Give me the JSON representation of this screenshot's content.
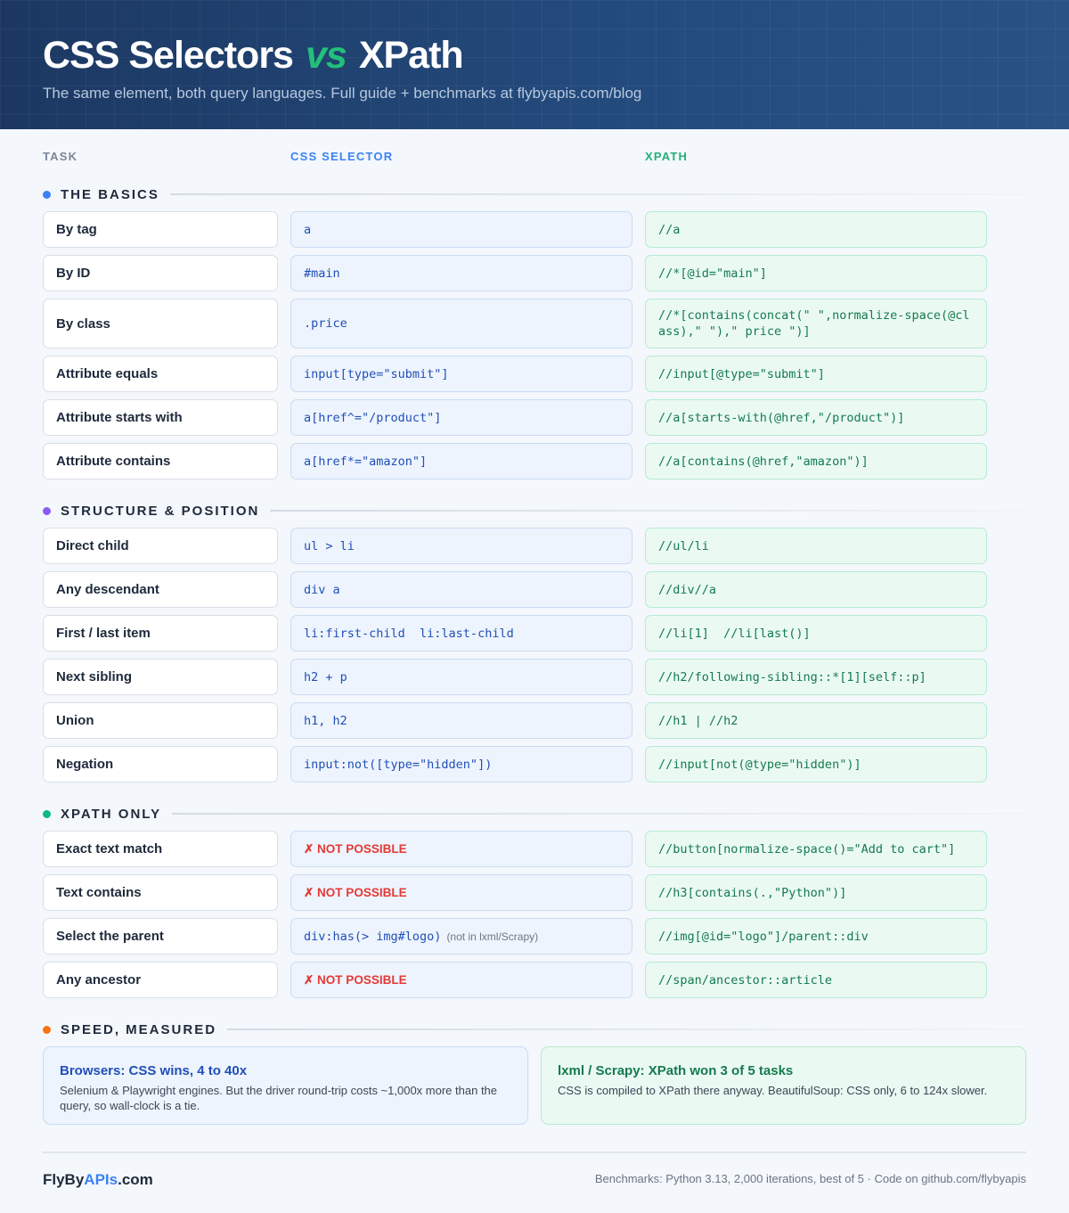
{
  "header": {
    "title_left": "CSS Selectors",
    "title_vs": "vs",
    "title_right": "XPath",
    "subtitle": "The same element, both query languages. Full guide + benchmarks at flybyapis.com/blog"
  },
  "columns": {
    "task": "TASK",
    "css": "CSS SELECTOR",
    "xpath": "XPATH"
  },
  "colors": {
    "css_accent": "#3b82f6",
    "xpath_accent": "#22b07a",
    "not_possible": "#e53935",
    "header_bg": "#22456f"
  },
  "sections": [
    {
      "label": "THE BASICS",
      "dot_color": "#3b82f6",
      "rows": [
        {
          "task": "By tag",
          "css": "a",
          "xpath": "//a"
        },
        {
          "task": "By ID",
          "css": "#main",
          "xpath": "//*[@id=\"main\"]"
        },
        {
          "task": "By class",
          "css": ".price",
          "xpath": "//*[contains(concat(\" \",normalize-space(@class),\" \"),\" price \")]"
        },
        {
          "task": "Attribute equals",
          "css": "input[type=\"submit\"]",
          "xpath": "//input[@type=\"submit\"]"
        },
        {
          "task": "Attribute starts with",
          "css": "a[href^=\"/product\"]",
          "xpath": "//a[starts-with(@href,\"/product\")]"
        },
        {
          "task": "Attribute contains",
          "css": "a[href*=\"amazon\"]",
          "xpath": "//a[contains(@href,\"amazon\")]"
        }
      ]
    },
    {
      "label": "STRUCTURE & POSITION",
      "dot_color": "#8b5cf6",
      "rows": [
        {
          "task": "Direct child",
          "css": "ul > li",
          "xpath": "//ul/li"
        },
        {
          "task": "Any descendant",
          "css": "div a",
          "xpath": "//div//a"
        },
        {
          "task": "First / last item",
          "css": "li:first-child  li:last-child",
          "xpath": "//li[1]  //li[last()]"
        },
        {
          "task": "Next sibling",
          "css": "h2 + p",
          "xpath": "//h2/following-sibling::*[1][self::p]"
        },
        {
          "task": "Union",
          "css": "h1, h2",
          "xpath": "//h1 | //h2"
        },
        {
          "task": "Negation",
          "css": "input:not([type=\"hidden\"])",
          "xpath": "//input[not(@type=\"hidden\")]"
        }
      ]
    },
    {
      "label": "XPATH ONLY",
      "dot_color": "#10b981",
      "rows": [
        {
          "task": "Exact text match",
          "css_not_possible": "✗ NOT POSSIBLE",
          "xpath": "//button[normalize-space()=\"Add to cart\"]"
        },
        {
          "task": "Text contains",
          "css_not_possible": "✗ NOT POSSIBLE",
          "xpath": "//h3[contains(.,\"Python\")]"
        },
        {
          "task": "Select the parent",
          "css": "div:has(> img#logo)",
          "css_note": "(not in lxml/Scrapy)",
          "xpath": "//img[@id=\"logo\"]/parent::div"
        },
        {
          "task": "Any ancestor",
          "css_not_possible": "✗ NOT POSSIBLE",
          "xpath": "//span/ancestor::article"
        }
      ]
    },
    {
      "label": "SPEED, MEASURED",
      "dot_color": "#f97316"
    }
  ],
  "speed": {
    "browsers": {
      "title": "Browsers: CSS wins, 4 to 40x",
      "body": "Selenium & Playwright engines. But the driver round-trip costs ~1,000x more than the query, so wall-clock is a tie."
    },
    "lxml": {
      "title": "lxml / Scrapy: XPath won 3 of 5 tasks",
      "body": "CSS is compiled to XPath there anyway. BeautifulSoup: CSS only, 6 to 124x slower."
    }
  },
  "footer": {
    "brand_prefix": "FlyBy",
    "brand_accent": "APIs",
    "brand_suffix": ".com",
    "note": "Benchmarks: Python 3.13, 2,000 iterations, best of 5 · Code on github.com/flybyapis"
  }
}
